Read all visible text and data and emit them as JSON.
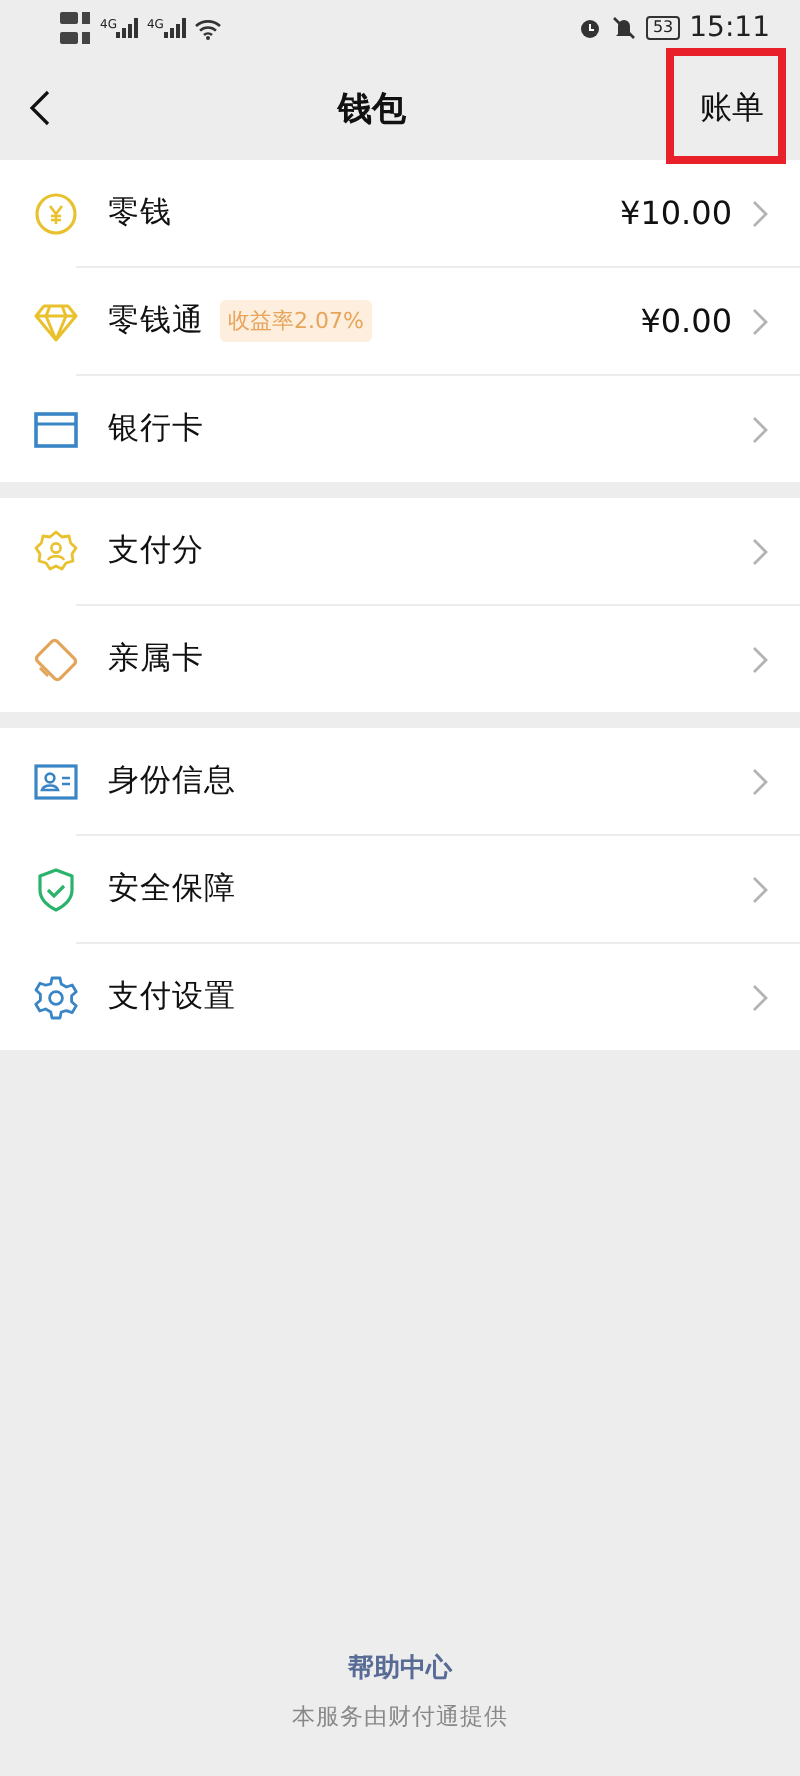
{
  "status_bar": {
    "network_1": "4G",
    "network_2": "4G",
    "battery": "53",
    "time": "15:11"
  },
  "header": {
    "title": "钱包",
    "action": {
      "label": "账单",
      "highlighted": true
    }
  },
  "groups": [
    {
      "items": [
        {
          "label": "零钱",
          "value": "¥10.00"
        },
        {
          "label": "零钱通",
          "badge": "收益率2.07%",
          "value": "¥0.00"
        },
        {
          "label": "银行卡"
        }
      ]
    },
    {
      "items": [
        {
          "label": "支付分"
        },
        {
          "label": "亲属卡"
        }
      ]
    },
    {
      "items": [
        {
          "label": "身份信息"
        },
        {
          "label": "安全保障"
        },
        {
          "label": "支付设置"
        }
      ]
    }
  ],
  "footer": {
    "help": "帮助中心",
    "provider": "本服务由财付通提供"
  }
}
